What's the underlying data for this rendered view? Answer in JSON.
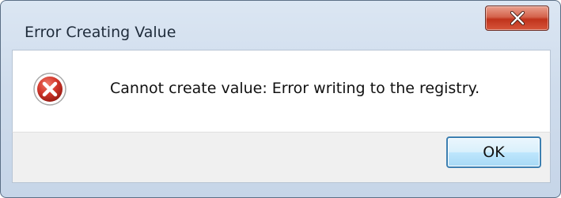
{
  "window": {
    "title": "Error Creating Value"
  },
  "titlebar": {
    "close_icon": "close-x-icon"
  },
  "content": {
    "icon": "error-icon",
    "message": "Cannot create value: Error writing to the registry."
  },
  "footer": {
    "ok_label": "OK"
  },
  "colors": {
    "close_button_red": "#c0331c",
    "error_icon_red": "#c9342c",
    "ok_button_border": "#3c7fb1",
    "footer_gray": "#f0f0f0"
  }
}
